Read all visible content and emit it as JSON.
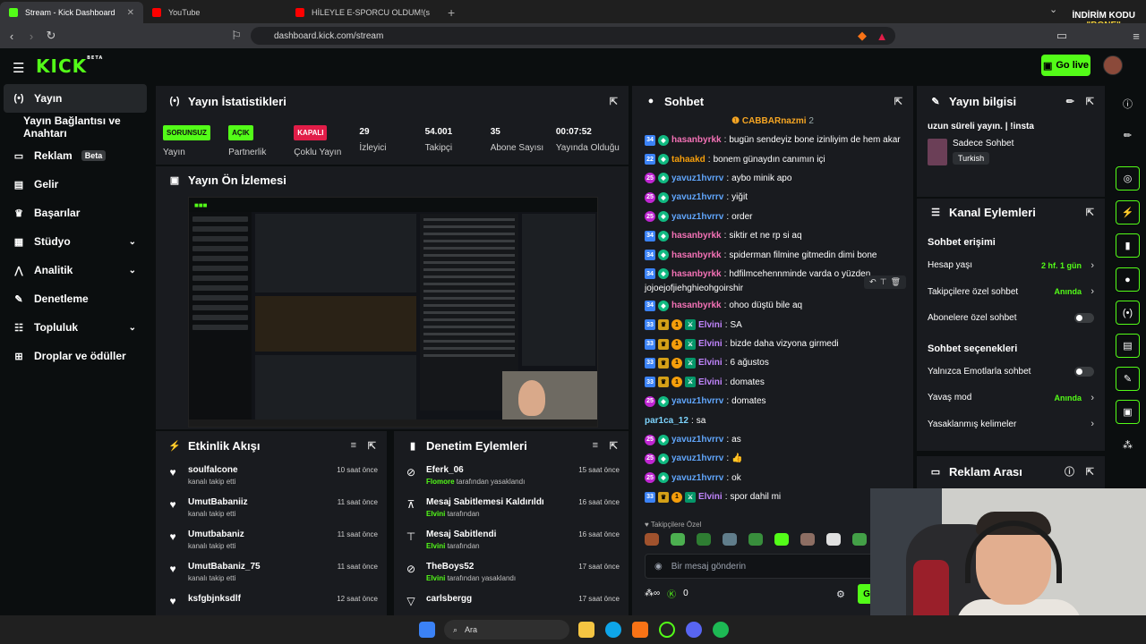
{
  "browser": {
    "tabs": [
      {
        "label": "Stream - Kick Dashboard",
        "color": "#53fc18"
      },
      {
        "label": "YouTube",
        "color": "#ff0000"
      },
      {
        "label": "HİLEYLE E-SPORCU OLDUM!(seçmele",
        "color": "#ff0000"
      }
    ],
    "url": "dashboard.kick.com/stream",
    "promo_line1": "İNDİRİM KODU",
    "promo_line2": "\"BONE\""
  },
  "header": {
    "logo": "KICK",
    "logo_beta": "BETA",
    "go_live": "Go live"
  },
  "sidebar": {
    "items": [
      {
        "label": "Yayın",
        "icon": "broadcast-icon"
      },
      {
        "label": "Yayın Bağlantısı ve Anahtarı"
      },
      {
        "label": "Reklam",
        "badge": "Beta",
        "icon": "ad-icon"
      },
      {
        "label": "Gelir",
        "icon": "wallet-icon"
      },
      {
        "label": "Başarılar",
        "icon": "trophy-icon"
      },
      {
        "label": "Stüdyo",
        "icon": "studio-icon"
      },
      {
        "label": "Analitik",
        "icon": "analytics-icon"
      },
      {
        "label": "Denetleme",
        "icon": "wrench-icon"
      },
      {
        "label": "Topluluk",
        "icon": "community-icon"
      },
      {
        "label": "Droplar ve ödüller",
        "icon": "drops-icon"
      }
    ]
  },
  "stats_panel": {
    "title": "Yayın İstatistikleri",
    "items": [
      {
        "badge": "SORUNSUZ",
        "badge_color": "#53fc18",
        "label": "Yayın"
      },
      {
        "badge": "AÇIK",
        "badge_color": "#53fc18",
        "label": "Partnerlik"
      },
      {
        "badge": "KAPALI",
        "badge_color": "#e11d48",
        "label": "Çoklu Yayın"
      },
      {
        "value": "29",
        "label": "İzleyici"
      },
      {
        "value": "54.001",
        "label": "Takipçi"
      },
      {
        "value": "35",
        "label": "Abone Sayısı"
      },
      {
        "value": "00:07:52",
        "label": "Yayında Olduğu"
      }
    ]
  },
  "preview_panel": {
    "title": "Yayın Ön İzlemesi"
  },
  "activity_panel": {
    "title": "Etkinlik Akışı",
    "rows": [
      {
        "name": "soulfalcone",
        "sub": "kanalı takip etti",
        "time": "10 saat önce"
      },
      {
        "name": "UmutBabaniiz",
        "sub": "kanalı takip etti",
        "time": "11 saat önce"
      },
      {
        "name": "Umutbabaniz",
        "sub": "kanalı takip etti",
        "time": "11 saat önce"
      },
      {
        "name": "UmutBabaniz_75",
        "sub": "kanalı takip etti",
        "time": "11 saat önce"
      },
      {
        "name": "ksfgbjnksdlf",
        "sub": "",
        "time": "12 saat önce"
      }
    ]
  },
  "moderation_panel": {
    "title": "Denetim Eylemleri",
    "rows": [
      {
        "name": "Eferk_06",
        "by": "Flomore",
        "sub": "tarafından yasaklandı",
        "time": "15 saat önce"
      },
      {
        "name": "Mesaj Sabitlemesi Kaldırıldı",
        "by": "Elvini",
        "sub": "tarafından",
        "time": "16 saat önce"
      },
      {
        "name": "Mesaj Sabitlendi",
        "by": "Elvini",
        "sub": "tarafından",
        "time": "16 saat önce"
      },
      {
        "name": "TheBoys52",
        "by": "Elvini",
        "sub": "tarafından yasaklandı",
        "time": "17 saat önce"
      },
      {
        "name": "carlsbergg",
        "by": "",
        "sub": "",
        "time": "17 saat önce"
      }
    ]
  },
  "chat": {
    "title": "Sohbet",
    "pinned_user": "CABBARnazmi",
    "pinned_count": "2",
    "messages": [
      {
        "badge": "34",
        "user": "hasanbyrkk",
        "color": "#f472b6",
        "text": "bugün sendeyiz bone izinliyim de hem akar"
      },
      {
        "badge": "22",
        "user": "tahaakd",
        "color": "#f59e0b",
        "text": "bonem günaydın canımın içi"
      },
      {
        "badge": "25",
        "user": "yavuz1hvrrv",
        "color": "#60a5fa",
        "text": "aybo minik apo"
      },
      {
        "badge": "25",
        "user": "yavuz1hvrrv",
        "color": "#60a5fa",
        "text": "yiğit"
      },
      {
        "badge": "25",
        "user": "yavuz1hvrrv",
        "color": "#60a5fa",
        "text": "order"
      },
      {
        "badge": "34",
        "user": "hasanbyrkk",
        "color": "#f472b6",
        "text": "siktir et ne rp si aq"
      },
      {
        "badge": "34",
        "user": "hasanbyrkk",
        "color": "#f472b6",
        "text": "spiderman filmine gitmedin dimi bone"
      },
      {
        "badge": "34",
        "user": "hasanbyrkk",
        "color": "#f472b6",
        "text": "hdfilmcehennminde varda o yüzden",
        "cont": "jojoejofjiehghieohgoirshir"
      },
      {
        "badge": "34",
        "user": "hasanbyrkk",
        "color": "#f472b6",
        "text": "ohoo düştü bile aq"
      },
      {
        "badge": "33",
        "user": "Elvini",
        "color": "#c084fc",
        "text": "SA",
        "mod": true
      },
      {
        "badge": "33",
        "user": "Elvini",
        "color": "#c084fc",
        "text": "bizde daha vizyona girmedi",
        "mod": true
      },
      {
        "badge": "33",
        "user": "Elvini",
        "color": "#c084fc",
        "text": "6 ağustos",
        "mod": true
      },
      {
        "badge": "33",
        "user": "Elvini",
        "color": "#c084fc",
        "text": "domates",
        "mod": true
      },
      {
        "badge": "25",
        "user": "yavuz1hvrrv",
        "color": "#60a5fa",
        "text": "domates"
      },
      {
        "badge": "",
        "user": "par1ca_12",
        "color": "#7dd3fc",
        "text": "sa"
      },
      {
        "badge": "25",
        "user": "yavuz1hvrrv",
        "color": "#60a5fa",
        "text": "as"
      },
      {
        "badge": "25",
        "user": "yavuz1hvrrv",
        "color": "#60a5fa",
        "text": "👍"
      },
      {
        "badge": "25",
        "user": "yavuz1hvrrv",
        "color": "#60a5fa",
        "text": "ok"
      },
      {
        "badge": "33",
        "user": "Elvini",
        "color": "#c084fc",
        "text": "spor dahil mi",
        "mod": true
      }
    ],
    "followers_only_label": "Takipçilere Özel",
    "input_placeholder": "Bir mesaj gönderin",
    "points": "0",
    "send_label": "G"
  },
  "stream_info": {
    "title": "Yayın bilgisi",
    "stream_title": "uzun süreli yayın. | !insta",
    "category": "Sadece Sohbet",
    "tag": "Turkish"
  },
  "channel_actions": {
    "title": "Kanal Eylemleri",
    "access_heading": "Sohbet erişimi",
    "account_age_label": "Hesap yaşı",
    "account_age_value": "2 hf. 1 gün",
    "followers_only_label": "Takipçilere özel sohbet",
    "followers_only_value": "Anında",
    "subs_only_label": "Abonelere özel sohbet",
    "options_heading": "Sohbet seçenekleri",
    "emote_only_label": "Yalnızca Emotlarla sohbet",
    "slow_mode_label": "Yavaş mod",
    "slow_mode_value": "Anında",
    "banned_words_label": "Yasaklanmış kelimeler"
  },
  "ad_break": {
    "title": "Reklam Arası"
  },
  "taskbar": {
    "search": "Ara"
  }
}
